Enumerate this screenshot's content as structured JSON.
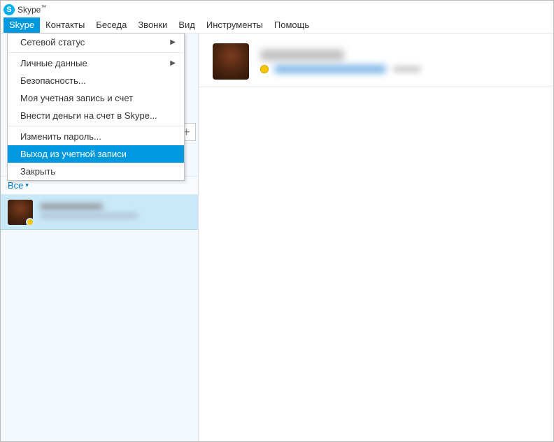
{
  "titlebar": {
    "app_name": "Skype",
    "trademark": "™"
  },
  "menubar": {
    "items": [
      "Skype",
      "Контакты",
      "Беседа",
      "Звонки",
      "Вид",
      "Инструменты",
      "Помощь"
    ],
    "active_index": 0
  },
  "dropdown": {
    "items": [
      {
        "label": "Сетевой статус",
        "has_submenu": true
      },
      {
        "sep": true
      },
      {
        "label": "Личные данные",
        "has_submenu": true
      },
      {
        "label": "Безопасность..."
      },
      {
        "label": "Моя учетная запись и счет"
      },
      {
        "label": "Внести деньги на счет в Skype..."
      },
      {
        "sep": true
      },
      {
        "label": "Изменить пароль..."
      },
      {
        "label": "Выход из учетной записи",
        "highlight": true
      },
      {
        "label": "Закрыть"
      }
    ]
  },
  "left_panel": {
    "add_button_glyph": "+",
    "filter_label": "Все"
  }
}
